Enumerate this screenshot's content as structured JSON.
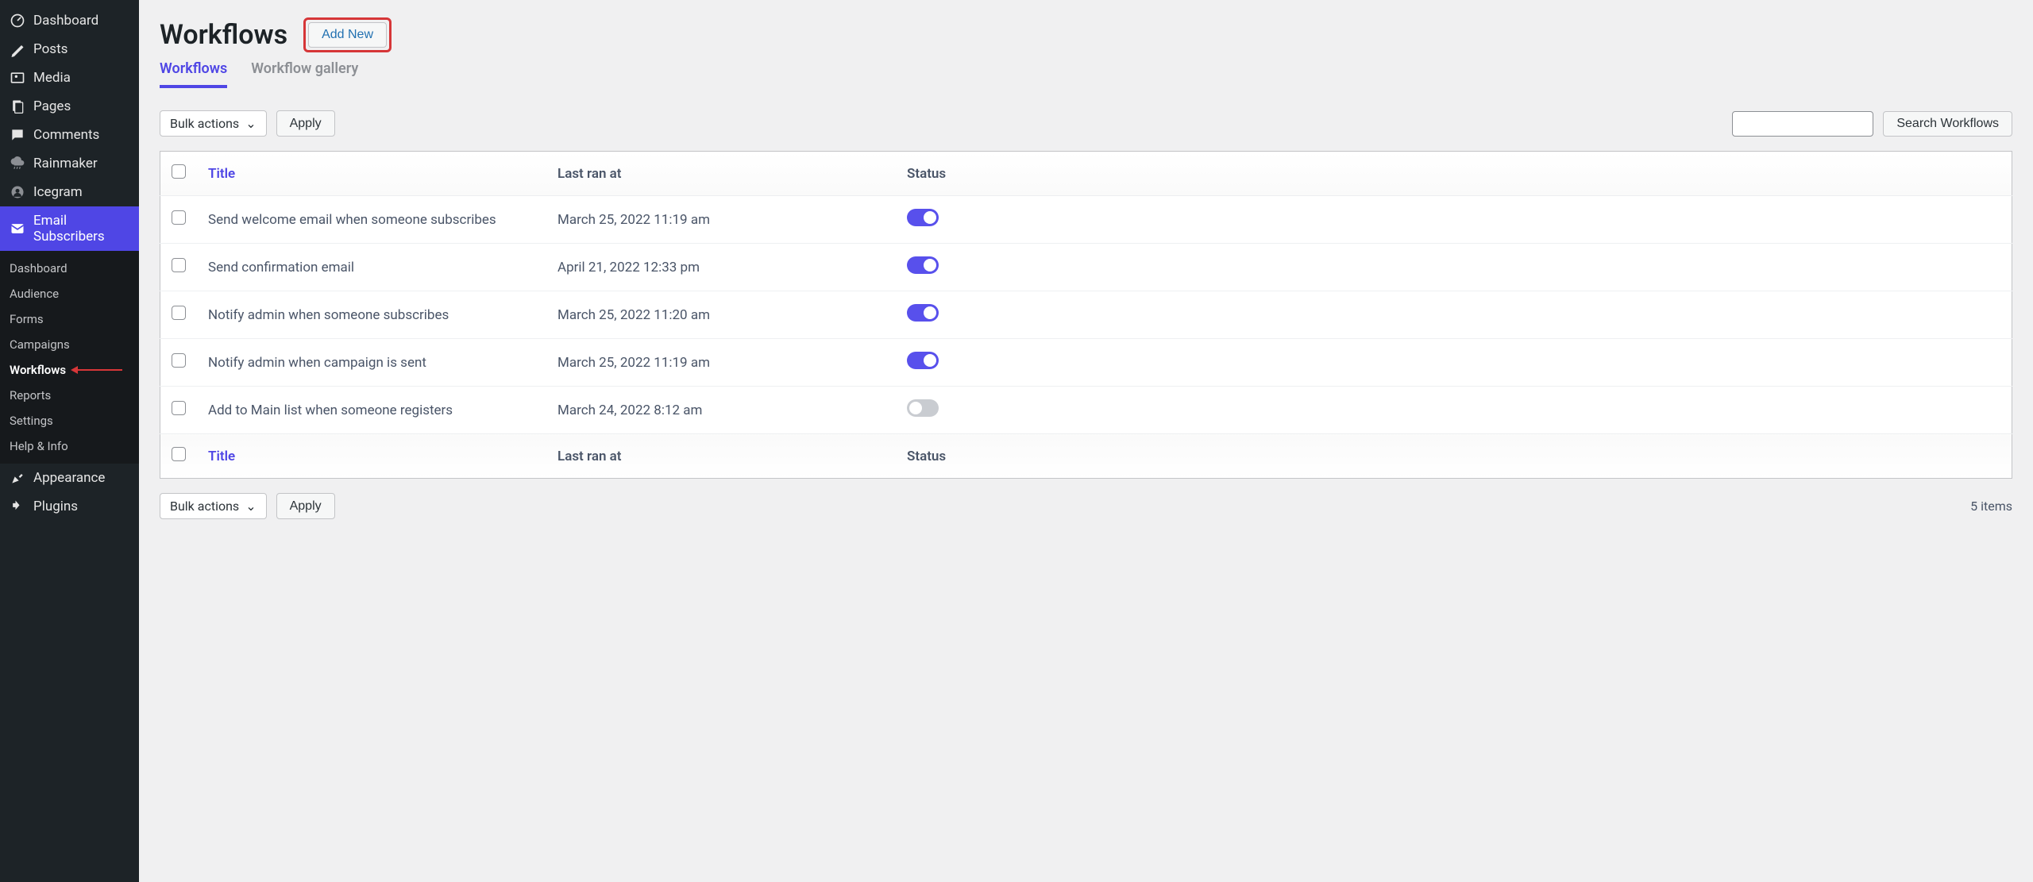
{
  "sidebar": {
    "items": [
      {
        "icon": "dashboard",
        "label": "Dashboard"
      },
      {
        "icon": "posts",
        "label": "Posts"
      },
      {
        "icon": "media",
        "label": "Media"
      },
      {
        "icon": "pages",
        "label": "Pages"
      },
      {
        "icon": "comments",
        "label": "Comments"
      },
      {
        "icon": "rainmaker",
        "label": "Rainmaker"
      },
      {
        "icon": "icegram",
        "label": "Icegram"
      },
      {
        "icon": "email",
        "label": "Email Subscribers"
      }
    ],
    "submenu": [
      {
        "label": "Dashboard"
      },
      {
        "label": "Audience"
      },
      {
        "label": "Forms"
      },
      {
        "label": "Campaigns"
      },
      {
        "label": "Workflows"
      },
      {
        "label": "Reports"
      },
      {
        "label": "Settings"
      },
      {
        "label": "Help & Info"
      }
    ],
    "bottom": [
      {
        "icon": "appearance",
        "label": "Appearance"
      },
      {
        "icon": "plugins",
        "label": "Plugins"
      }
    ]
  },
  "header": {
    "title": "Workflows",
    "add_new": "Add New"
  },
  "tabs": [
    {
      "label": "Workflows",
      "active": true
    },
    {
      "label": "Workflow gallery",
      "active": false
    }
  ],
  "toolbar": {
    "bulk_label": "Bulk actions",
    "apply_label": "Apply",
    "search_label": "Search Workflows"
  },
  "table": {
    "columns": {
      "title": "Title",
      "last_ran": "Last ran at",
      "status": "Status"
    },
    "rows": [
      {
        "title": "Send welcome email when someone subscribes",
        "date": "March 25, 2022 11:19 am",
        "on": true
      },
      {
        "title": "Send confirmation email",
        "date": "April 21, 2022 12:33 pm",
        "on": true
      },
      {
        "title": "Notify admin when someone subscribes",
        "date": "March 25, 2022 11:20 am",
        "on": true
      },
      {
        "title": "Notify admin when campaign is sent",
        "date": "March 25, 2022 11:19 am",
        "on": true
      },
      {
        "title": "Add to Main list when someone registers",
        "date": "March 24, 2022 8:12 am",
        "on": false
      }
    ]
  },
  "footer": {
    "count": "5 items"
  }
}
